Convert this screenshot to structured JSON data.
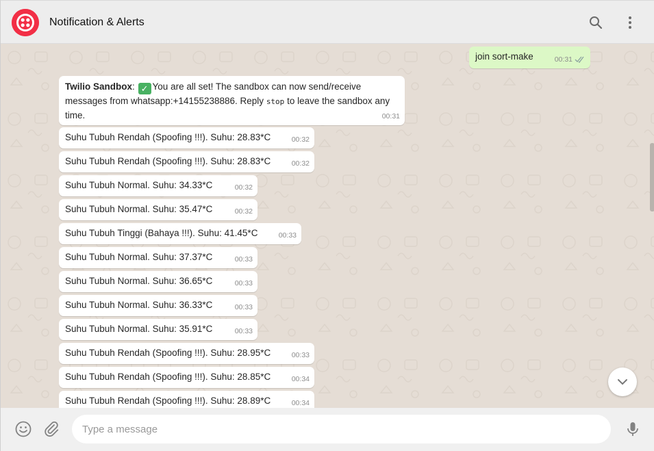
{
  "header": {
    "title": "Notification & Alerts",
    "avatar_icon": "twilio-logo-icon",
    "search_icon": "search-icon",
    "menu_icon": "more-vertical-icon",
    "brand_color": "#f22f46"
  },
  "outgoing": {
    "text": "join sort-make",
    "time": "00:31"
  },
  "welcome": {
    "sender": "Twilio Sandbox",
    "text_1": "You are all set! The sandbox can now send/receive messages from whatsapp:+14155238886. Reply ",
    "code": "stop",
    "text_2": " to leave the sandbox any time.",
    "time": "00:31"
  },
  "messages": [
    {
      "text": "Suhu Tubuh Rendah (Spoofing !!!). Suhu: 28.83*C",
      "time": "00:32"
    },
    {
      "text": "Suhu Tubuh Rendah (Spoofing !!!). Suhu: 28.83*C",
      "time": "00:32"
    },
    {
      "text": "Suhu Tubuh Normal. Suhu: 34.33*C",
      "time": "00:32"
    },
    {
      "text": "Suhu Tubuh Normal. Suhu: 35.47*C",
      "time": "00:32"
    },
    {
      "text": "Suhu Tubuh Tinggi (Bahaya !!!). Suhu: 41.45*C",
      "time": "00:33"
    },
    {
      "text": "Suhu Tubuh Normal. Suhu: 37.37*C",
      "time": "00:33"
    },
    {
      "text": "Suhu Tubuh Normal. Suhu: 36.65*C",
      "time": "00:33"
    },
    {
      "text": "Suhu Tubuh Normal. Suhu: 36.33*C",
      "time": "00:33"
    },
    {
      "text": "Suhu Tubuh Normal. Suhu: 35.91*C",
      "time": "00:33"
    },
    {
      "text": "Suhu Tubuh Rendah (Spoofing !!!). Suhu: 28.95*C",
      "time": "00:33"
    },
    {
      "text": "Suhu Tubuh Rendah (Spoofing !!!). Suhu: 28.85*C",
      "time": "00:34"
    },
    {
      "text": "Suhu Tubuh Rendah (Spoofing !!!). Suhu: 28.89*C",
      "time": "00:34"
    }
  ],
  "composer": {
    "placeholder": "Type a message",
    "emoji_icon": "emoji-icon",
    "attach_icon": "paperclip-icon",
    "mic_icon": "microphone-icon"
  },
  "scroll_down_icon": "chevron-down-icon"
}
